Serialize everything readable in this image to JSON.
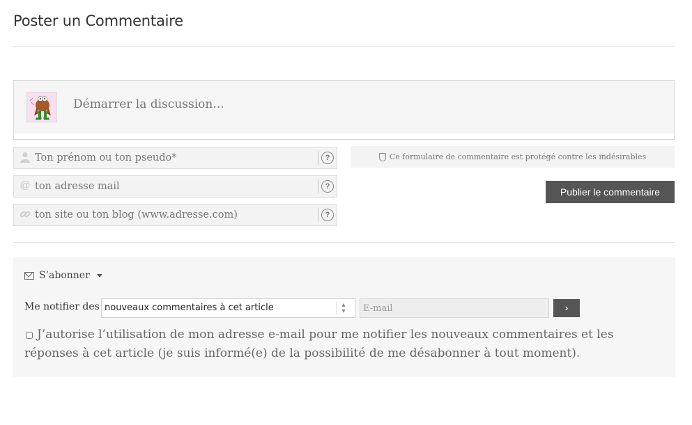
{
  "header": {
    "title": "Poster un Commentaire"
  },
  "discussion": {
    "placeholder": "Démarrer la discussion..."
  },
  "form": {
    "name_placeholder": "Ton prénom ou ton pseudo*",
    "email_placeholder": "ton adresse mail",
    "website_placeholder": "ton site ou ton blog (www.adresse.com)",
    "help_glyph": "?",
    "protection_text": "Ce formulaire de commentaire est protégé contre les indésirables",
    "publish_label": "Publier le commentaire"
  },
  "subscribe": {
    "toggle_label": "S’abonner",
    "notify_label": "Me notifier des",
    "select_value": "nouveaux commentaires à cet article",
    "email_placeholder": "E-mail",
    "go_label": "›",
    "consent_text": "J’autorise l’utilisation de mon adresse e-mail pour me notifier les nouveaux commentaires et les réponses à cet article (je suis informé(e) de la possibilité de me désabonner à tout moment)."
  },
  "icons": {
    "name": "user-icon",
    "email": "at-icon",
    "website": "link-icon",
    "help": "question-circle-icon",
    "shield": "shield-icon",
    "subscribe": "envelope-icon",
    "caret": "caret-down-icon"
  },
  "colors": {
    "button_bg": "#555555",
    "field_bg": "#f3f3f3",
    "panel_bg": "#f6f6f6"
  }
}
